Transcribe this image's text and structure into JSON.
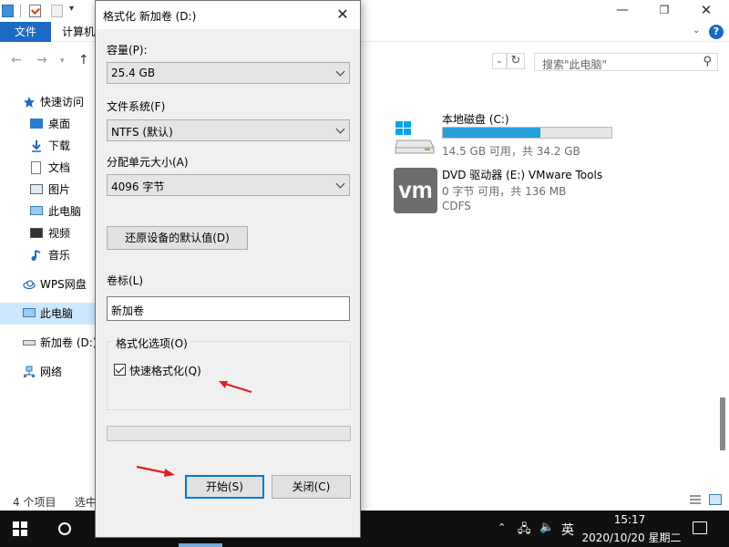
{
  "explorer": {
    "ribbon": {
      "file_tab": "文件",
      "computer_tab": "计算机"
    },
    "search": {
      "placeholder": "搜索\"此电脑\""
    },
    "sidebar": {
      "quick_access": "快速访问",
      "items": [
        "桌面",
        "下载",
        "文档",
        "图片",
        "此电脑",
        "视频",
        "音乐"
      ],
      "wps": "WPS网盘",
      "this_pc": "此电脑",
      "new_volume": "新加卷 (D:)",
      "network": "网络"
    },
    "drives": [
      {
        "name": "本地磁盘 (C:)",
        "free": "14.5 GB 可用，共 34.2 GB",
        "used_fraction": 0.576
      },
      {
        "name": "DVD 驱动器 (E:) VMware Tools",
        "free": "0 字节 可用，共 136 MB",
        "fs": "CDFS"
      }
    ],
    "status": {
      "count": "4 个项目",
      "selected": "选中"
    }
  },
  "dialog": {
    "title": "格式化 新加卷 (D:)",
    "capacity_label": "容量(P):",
    "capacity_value": "25.4 GB",
    "fs_label": "文件系统(F)",
    "fs_value": "NTFS (默认)",
    "alloc_label": "分配单元大小(A)",
    "alloc_value": "4096 字节",
    "restore_button": "还原设备的默认值(D)",
    "volume_label": "卷标(L)",
    "volume_value": "新加卷",
    "options_legend": "格式化选项(O)",
    "quick_format": "快速格式化(Q)",
    "quick_format_checked": true,
    "start_button": "开始(S)",
    "close_button": "关闭(C)",
    "progress": 0
  },
  "taskbar": {
    "ime": "英",
    "time": "15:17",
    "date": "2020/10/20 星期二"
  },
  "colors": {
    "accent": "#1b6ac3",
    "drive_bar": "#26a0da",
    "annotation": "#e02020",
    "selection": "#cce8ff"
  }
}
